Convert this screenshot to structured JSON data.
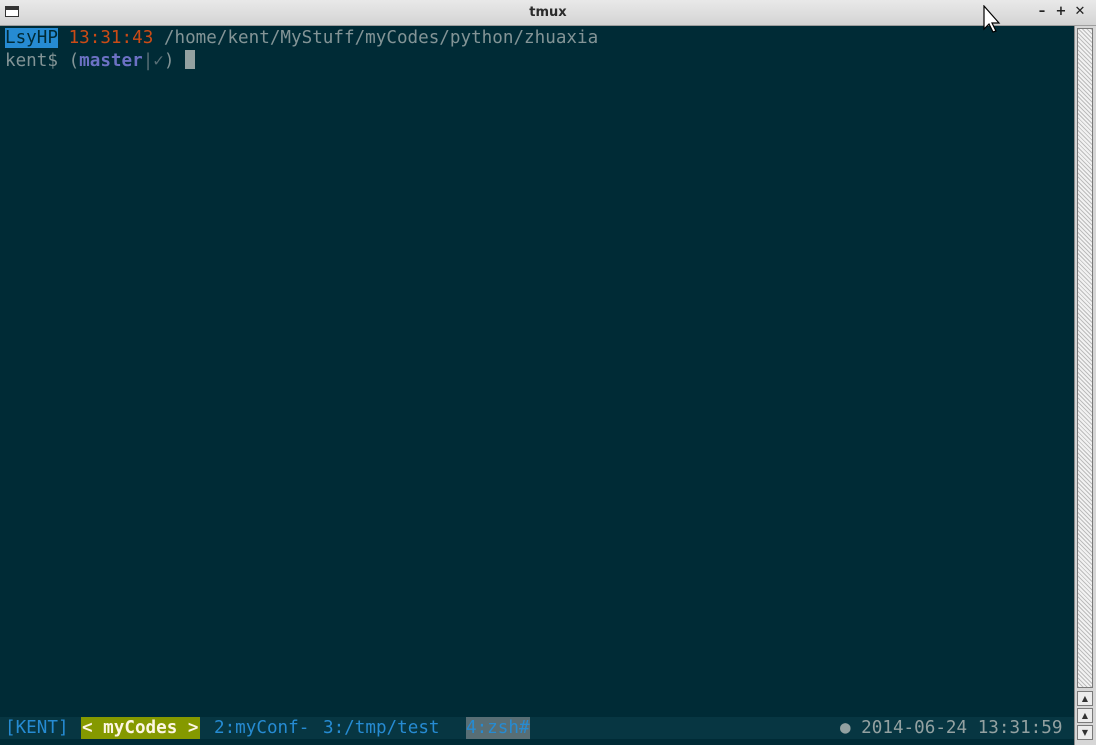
{
  "window": {
    "title": "tmux",
    "buttons": {
      "minimize": "–",
      "maximize": "+",
      "close": "✕"
    }
  },
  "terminal": {
    "line1": {
      "host": "LsyHP",
      "time": "13:31:43",
      "path": "/home/kent/MyStuff/myCodes/python/zhuaxia"
    },
    "line2": {
      "user_prompt": "kent$ ",
      "open_paren": "(",
      "branch": "master",
      "git_status": "|✓",
      "close_paren": ")"
    }
  },
  "status_bar": {
    "session": "[KENT]",
    "current_window": "< myCodes >",
    "windows": [
      "2:myConf-",
      "3:/tmp/test",
      "4:zsh#"
    ],
    "right": "● 2014-06-24 13:31:59"
  },
  "colors": {
    "background": "#002b36",
    "status_background": "#073642",
    "host_highlight": "#268bd2",
    "clock": "#cb4b16",
    "branch": "#6c71c4",
    "current_window": "#859900"
  },
  "icons": {
    "window_menu": "window-menu-icon",
    "scroll_up": "arrow-up-icon",
    "scroll_down": "arrow-down-icon",
    "pointer": "mouse-pointer-icon"
  }
}
